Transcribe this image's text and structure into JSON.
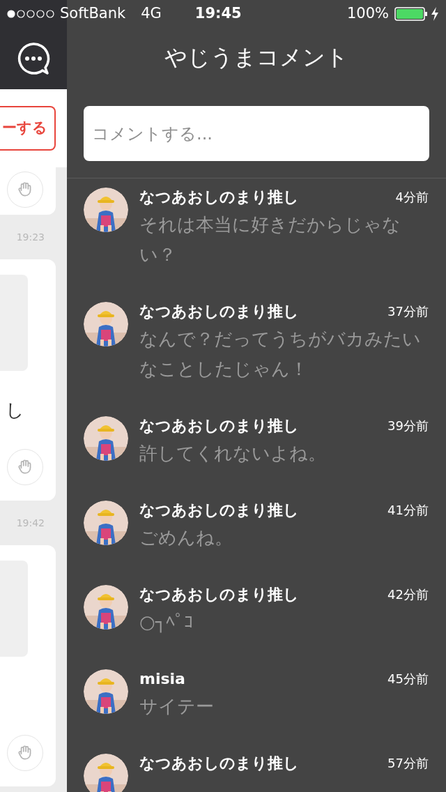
{
  "status_bar": {
    "carrier": "SoftBank",
    "network": "4G",
    "time": "19:45",
    "battery": "100%"
  },
  "background_feed": {
    "follow_button": "ーする",
    "cards": [
      {
        "timestamp": "19:23",
        "text": "し"
      },
      {
        "timestamp": "19:42"
      }
    ]
  },
  "panel": {
    "title": "やじうまコメント",
    "comment_field": {
      "placeholder": "コメントする..."
    },
    "comments": [
      {
        "user": "なつあおしのまり推し",
        "time": "4分前",
        "text": "それは本当に好きだからじゃない？"
      },
      {
        "user": "なつあおしのまり推し",
        "time": "37分前",
        "text": "なんで？だってうちがバカみたいなことしたじゃん！"
      },
      {
        "user": "なつあおしのまり推し",
        "time": "39分前",
        "text": "許してくれないよね。"
      },
      {
        "user": "なつあおしのまり推し",
        "time": "41分前",
        "text": "ごめんね。"
      },
      {
        "user": "なつあおしのまり推し",
        "time": "42分前",
        "text": "○┐ﾍﾟｺ"
      },
      {
        "user": "misia",
        "time": "45分前",
        "text": "サイテー"
      },
      {
        "user": "なつあおしのまり推し",
        "time": "57分前"
      }
    ]
  }
}
